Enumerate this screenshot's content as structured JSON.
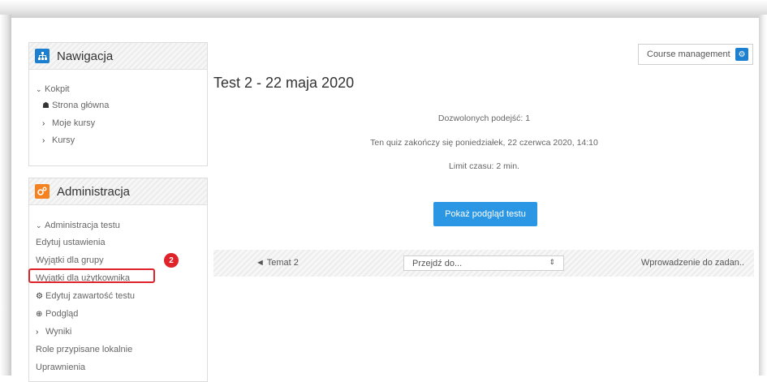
{
  "navigation": {
    "title": "Nawigacja",
    "icon": "sitemap-icon",
    "items": [
      {
        "label": "Kokpit",
        "glyph": "⌄"
      },
      {
        "label": "Strona główna",
        "glyph": "☗"
      },
      {
        "label": "Moje kursy",
        "glyph": "›"
      },
      {
        "label": "Kursy",
        "glyph": "›"
      }
    ]
  },
  "administration": {
    "title": "Administracja",
    "icon": "cogs-icon",
    "items": [
      {
        "label": "Administracja testu",
        "glyph": "⌄"
      },
      {
        "label": "Edytuj ustawienia",
        "glyph": ""
      },
      {
        "label": "Wyjątki dla grupy",
        "glyph": ""
      },
      {
        "label": "Wyjątki dla użytkownika",
        "glyph": ""
      },
      {
        "label": "Edytuj zawartość testu",
        "glyph": "⚙"
      },
      {
        "label": "Podgląd",
        "glyph": "⊕"
      },
      {
        "label": "Wyniki",
        "glyph": "›"
      },
      {
        "label": "Role przypisane lokalnie",
        "glyph": ""
      },
      {
        "label": "Uprawnienia",
        "glyph": ""
      }
    ],
    "callout_number": "2"
  },
  "header": {
    "course_management_label": "Course management",
    "gear_glyph": "⚙"
  },
  "quiz": {
    "title": "Test 2 - 22 maja 2020",
    "attempts": "Dozwolonych podejść: 1",
    "closes": "Ten quiz zakończy się poniedziałek, 22 czerwca 2020, 14:10",
    "time_limit": "Limit czasu: 2 min.",
    "preview_button": "Pokaż podgląd testu"
  },
  "activity_nav": {
    "prev_label": "◄ Temat 2",
    "jump_label": "Przejdź do...",
    "jump_arrow": "⇕",
    "next_label": "Wprowadzenie do zadan.."
  },
  "colors": {
    "nav_icon_bg": "#1d7fd0",
    "admin_icon_bg": "#f58220",
    "accent_blue": "#2b97e4",
    "highlight_red": "#e0232b"
  }
}
